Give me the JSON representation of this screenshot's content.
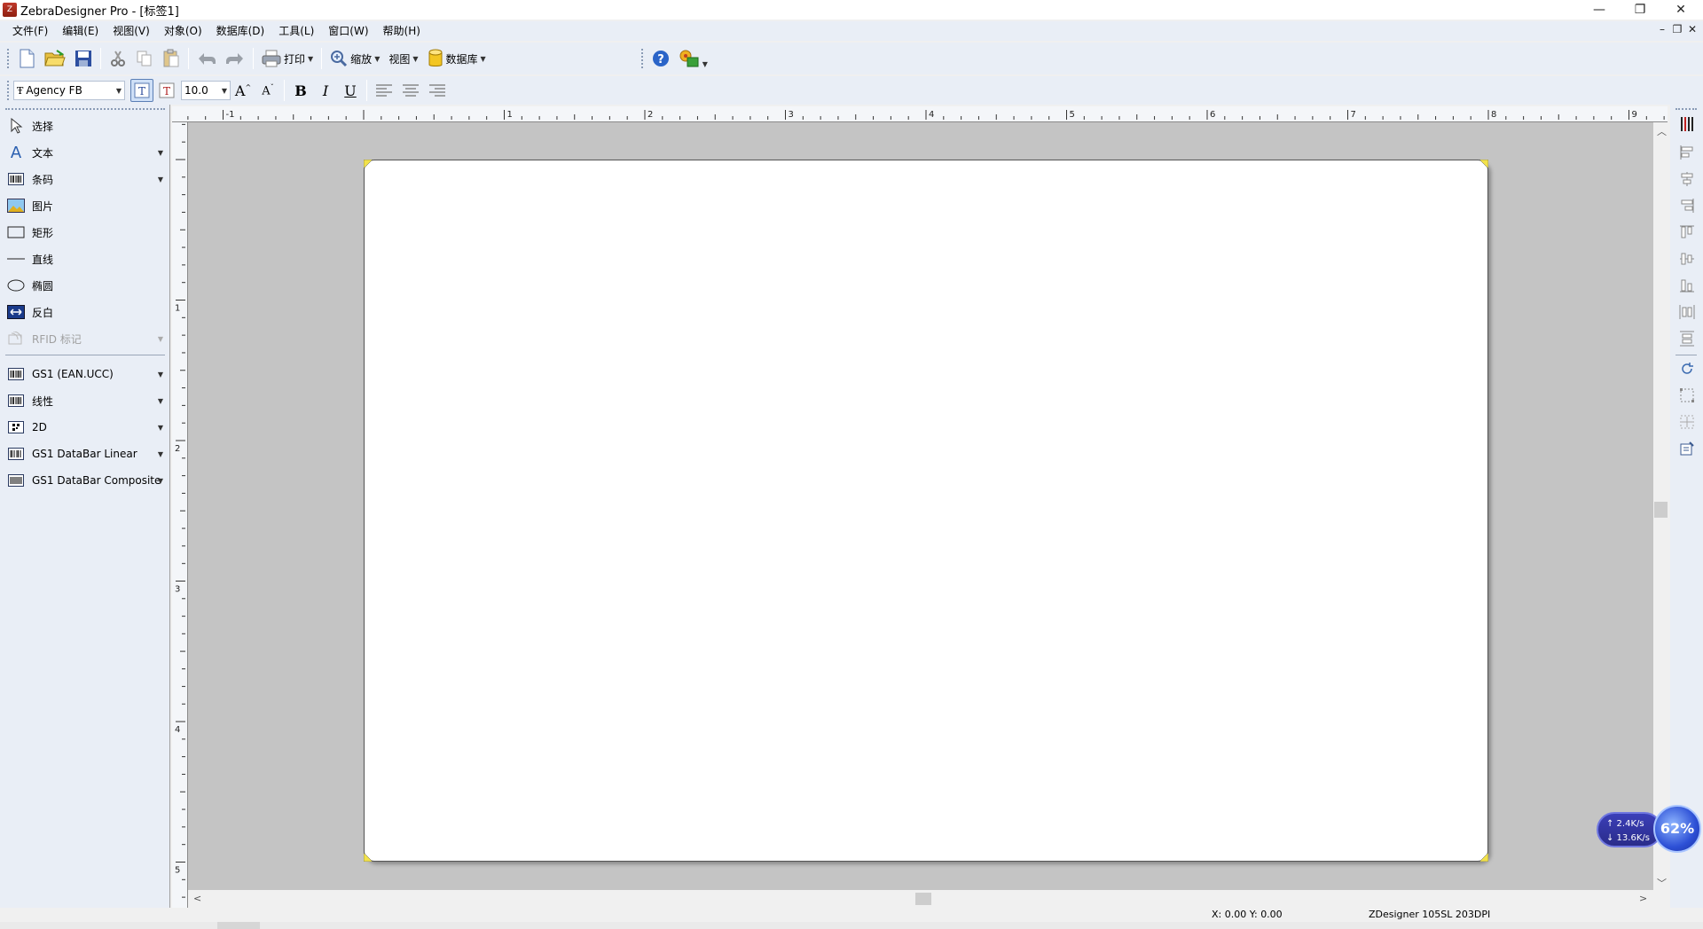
{
  "window": {
    "title": "ZebraDesigner Pro - [标签1]",
    "app_icon": "zebra-app-icon",
    "controls": {
      "minimize": "—",
      "restore": "❐",
      "close": "✕"
    },
    "mdi_controls": {
      "minimize": "–",
      "restore": "❐",
      "close": "✕"
    }
  },
  "menu": [
    {
      "id": "file",
      "label": "文件(F)"
    },
    {
      "id": "edit",
      "label": "编辑(E)"
    },
    {
      "id": "view",
      "label": "视图(V)"
    },
    {
      "id": "object",
      "label": "对象(O)"
    },
    {
      "id": "database",
      "label": "数据库(D)"
    },
    {
      "id": "tools",
      "label": "工具(L)"
    },
    {
      "id": "window",
      "label": "窗口(W)"
    },
    {
      "id": "help",
      "label": "帮助(H)"
    }
  ],
  "toolbar": {
    "print_label": "打印",
    "zoom_label": "缩放",
    "view_label": "视图",
    "database_label": "数据库"
  },
  "format": {
    "font": "Agency FB",
    "size": "10.0",
    "bold": "B",
    "italic": "I",
    "underline": "U"
  },
  "toolbox": {
    "tools": [
      {
        "id": "select",
        "label": "选择"
      },
      {
        "id": "text",
        "label": "文本"
      },
      {
        "id": "barcode",
        "label": "条码"
      },
      {
        "id": "picture",
        "label": "图片"
      },
      {
        "id": "rectangle",
        "label": "矩形"
      },
      {
        "id": "line",
        "label": "直线"
      },
      {
        "id": "ellipse",
        "label": "椭圆"
      },
      {
        "id": "inverse",
        "label": "反白"
      },
      {
        "id": "rfid",
        "label": "RFID 标记"
      }
    ],
    "barcodes": [
      {
        "id": "gs1",
        "label": "GS1 (EAN.UCC)"
      },
      {
        "id": "linear",
        "label": "线性"
      },
      {
        "id": "2d",
        "label": "2D"
      },
      {
        "id": "gs1-databar-linear",
        "label": "GS1 DataBar Linear"
      },
      {
        "id": "gs1-databar-composite",
        "label": "GS1 DataBar Composite"
      }
    ]
  },
  "ruler": {
    "top_labels": [
      "-1",
      "1",
      "2",
      "3",
      "4",
      "5",
      "6",
      "7",
      "8",
      "9"
    ],
    "left_labels": [
      "1",
      "2",
      "3",
      "4",
      "5"
    ]
  },
  "status": {
    "coords": "X:  0.00 Y:  0.00",
    "printer": "ZDesigner 105SL 203DPI"
  },
  "net_widget": {
    "up": "↑ 2.4K/s",
    "down": "↓ 13.6K/s",
    "percent": "62%"
  },
  "colors": {
    "toolbar_bg": "#e9eef6",
    "canvas_bg": "#c4c4c4",
    "label_bg": "#ffffff",
    "corner_marker": "#f2e24a"
  }
}
